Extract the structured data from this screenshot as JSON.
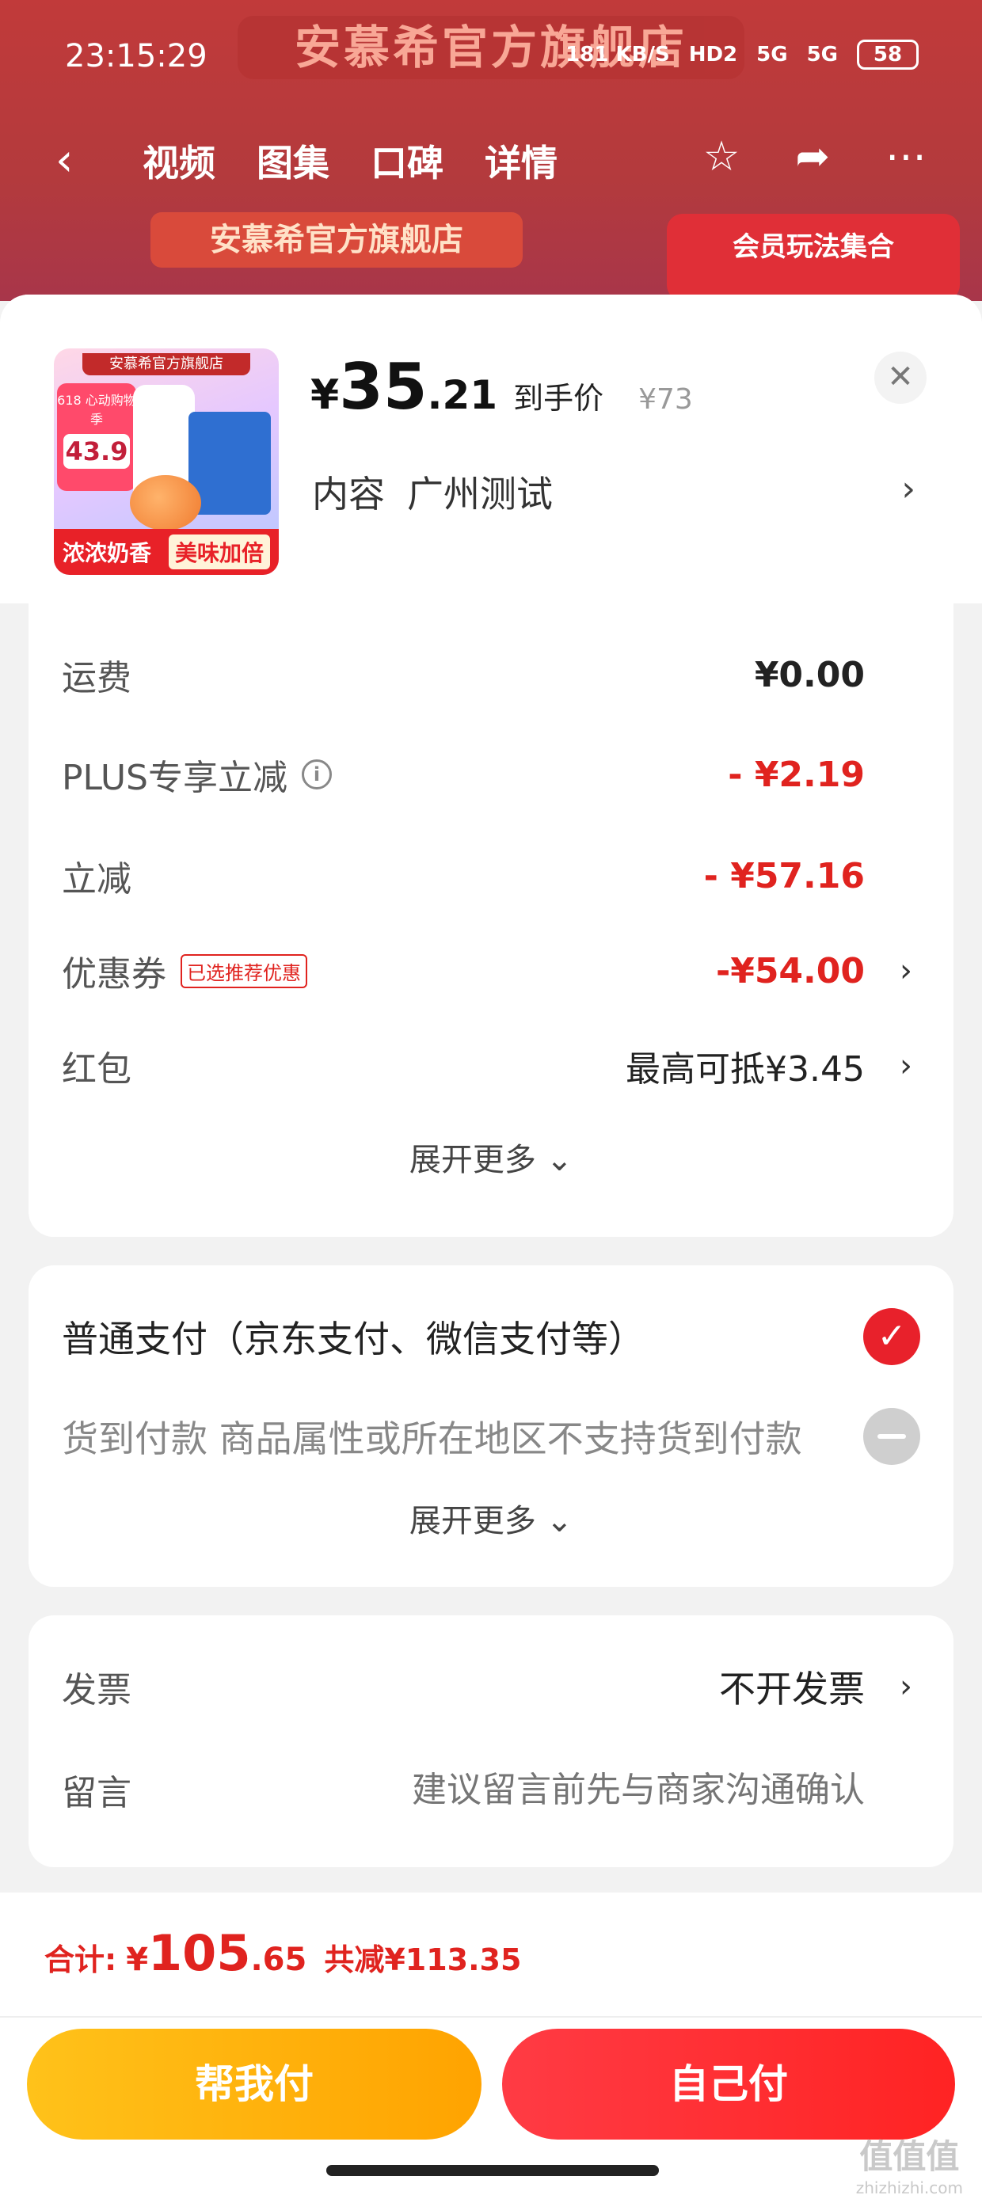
{
  "status_bar": {
    "time": "23:15:29",
    "net_speed": "181 KB/S",
    "hd": "HD2",
    "signal1": "5G",
    "signal2": "5G",
    "battery": "58"
  },
  "background": {
    "store_title": "安慕希官方旗舰店",
    "banner": "安慕希官方旗舰店",
    "promo": "会员玩法集合",
    "tabs": [
      "视频",
      "图集",
      "口碑",
      "详情"
    ]
  },
  "product": {
    "image": {
      "store": "安慕希官方旗舰店",
      "badge_top": "618 心动购物季",
      "badge_price": "43.9",
      "bottom_left": "浓浓奶香",
      "bottom_right": "美味加倍"
    },
    "price_yen": "¥",
    "price_int": "35",
    "price_dec": ".21",
    "price_tag": "到手价",
    "original_price": "¥73",
    "spec_label": "内容",
    "spec_value": "广州测试"
  },
  "cost": {
    "rows": [
      {
        "label": "运费",
        "value": "¥0.00"
      },
      {
        "label": "PLUS专享立减",
        "value": "- ¥2.19"
      },
      {
        "label": "立减",
        "value": "- ¥57.16"
      },
      {
        "label": "优惠券",
        "tag": "已选推荐优惠",
        "value": "-¥54.00"
      },
      {
        "label": "红包",
        "value": "最高可抵¥3.45"
      }
    ],
    "expand_label": "展开更多"
  },
  "payment": {
    "options": [
      {
        "label": "普通支付（京东支付、微信支付等）"
      },
      {
        "label": "货到付款 商品属性或所在地区不支持货到付款"
      }
    ],
    "expand_label": "展开更多"
  },
  "invoice": {
    "invoice_label": "发票",
    "invoice_value": "不开发票",
    "message_label": "留言",
    "message_placeholder": "建议留言前先与商家沟通确认"
  },
  "footer": {
    "total_label": "合计:",
    "total_yen": "¥",
    "total_int": "105",
    "total_dec": ".65",
    "total_saved": "共减¥113.35",
    "help_pay": "帮我付",
    "self_pay": "自己付"
  },
  "watermark": {
    "logo": "值值值",
    "url": "zhizhizhi.com"
  },
  "colors": {
    "accent_red": "#e0231f",
    "help_yellow": "#ffb300",
    "self_red": "#ff2b34"
  }
}
